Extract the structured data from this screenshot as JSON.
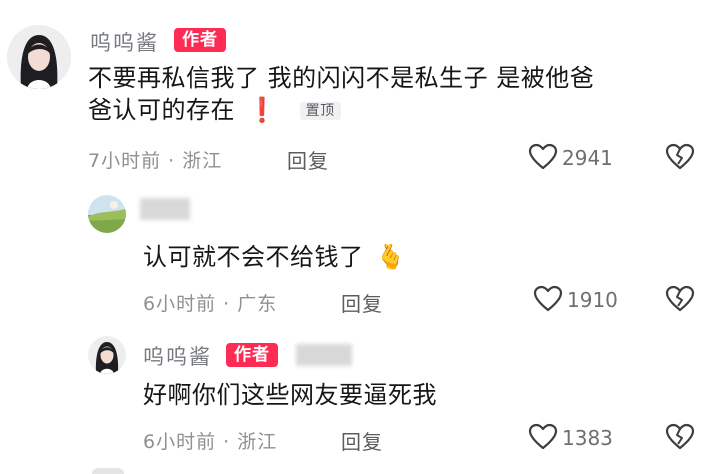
{
  "comments": [
    {
      "username": "呜呜酱",
      "author_badge": "作者",
      "text_line1": "不要再私信我了 我的闪闪不是私生子 是被他爸",
      "text_line2": "爸认可的存在",
      "exclaim_emoji": "❗",
      "pinned_label": "置顶",
      "time_location": "7小时前 · 浙江",
      "reply_label": "回复",
      "like_count": "2941"
    },
    {
      "username": "",
      "text": "认可就不会不给钱了",
      "emoji": "🫰",
      "time_location": "6小时前 · 广东",
      "reply_label": "回复",
      "like_count": "1910"
    },
    {
      "username": "呜呜酱",
      "author_badge": "作者",
      "text": "好啊你们这些网友要逼死我",
      "time_location": "6小时前 · 浙江",
      "reply_label": "回复",
      "like_count": "1383"
    }
  ],
  "icons": {
    "like": "heart-outline-icon",
    "dislike": "broken-heart-icon"
  },
  "colors": {
    "author_badge": "#fe2c55",
    "pin_bg": "#f1f1f3",
    "meta_text": "#8f8f94"
  }
}
